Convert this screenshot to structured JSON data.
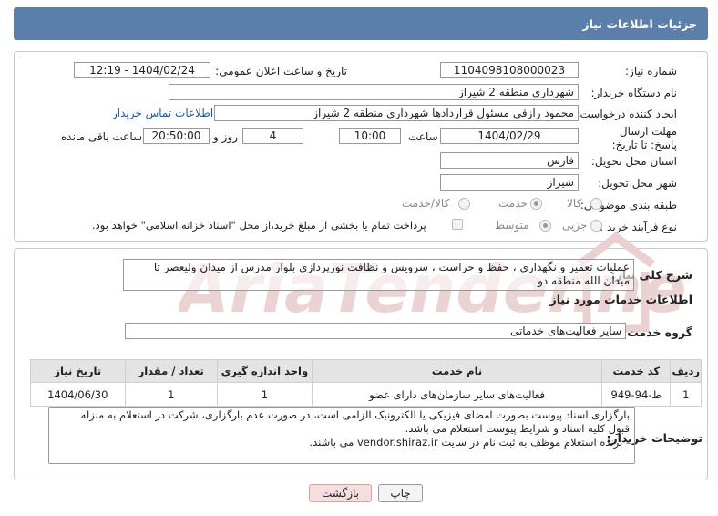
{
  "header": {
    "title": "جزئیات اطلاعات نیاز"
  },
  "need_number": {
    "label": "شماره نیاز:",
    "value": "1104098108000023"
  },
  "announce": {
    "label": "تاریخ و ساعت اعلان عمومی:",
    "value": "1404/02/24 - 12:19"
  },
  "buyer": {
    "label": "نام دستگاه خریدار:",
    "value": "شهرداری منطقه 2 شیراز"
  },
  "creator": {
    "label": "ایجاد کننده درخواست:",
    "value": "محمود رازقی مسئول قراردادها شهرداری منطقه 2 شیراز",
    "contact_link": "اطلاعات تماس خریدار"
  },
  "deadline": {
    "label": "مهلت ارسال پاسخ: تا تاریخ:",
    "date": "1404/02/29",
    "time_label": "ساعت",
    "time": "10:00",
    "days": "4",
    "days_label": "روز و",
    "remaining": "20:50:00",
    "remaining_label": "ساعت باقی مانده"
  },
  "province": {
    "label": "استان محل تحویل:",
    "value": "فارس"
  },
  "city": {
    "label": "شهر محل تحویل:",
    "value": "شیراز"
  },
  "category": {
    "label": "طبقه بندی موضوعی:",
    "options": [
      "کالا",
      "خدمت",
      "کالا/خدمت"
    ],
    "selected": "خدمت"
  },
  "process": {
    "label": "نوع فرآیند خرید :",
    "options": [
      "جزیی",
      "متوسط"
    ],
    "selected": "متوسط",
    "payment_note": "پرداخت تمام یا بخشی از مبلغ خرید،از محل \"اسناد خزانه اسلامی\" خواهد بود."
  },
  "description": {
    "label": "شرح کلی نیاز:",
    "text": "عملیات تعمیر و نگهداری ، حفظ و حراست ، سرویس و نظافت نورپردازی بلوار مدرس از میدان ولیعصر تا میدان الله منطقه دو"
  },
  "services_title": "اطلاعات خدمات مورد نیاز",
  "service_group": {
    "label": "گروه خدمت:",
    "value": "سایر فعالیت‌های خدماتی"
  },
  "table": {
    "headers": [
      "ردیف",
      "کد خدمت",
      "نام خدمت",
      "واحد اندازه گیری",
      "تعداد / مقدار",
      "تاریخ نیاز"
    ],
    "rows": [
      [
        "1",
        "ط-94-949",
        "فعالیت‌های سایر سازمان‌های دارای عضو",
        "1",
        "1",
        "1404/06/30"
      ]
    ]
  },
  "buyer_notes": {
    "label": "توضیحات خریدار:",
    "lines": [
      "بارگزاری اسناد پیوست بصورت امضای فیزیکی یا الکترونیک الزامی است، در صورت عدم بارگزاری، شرکت در استعلام به منزله",
      "قبول کلیه اسناد و شرایط پیوست استعلام می باشد.",
      "- برنده استعلام موظف به ثبت نام در سایت vendor.shiraz.ir می باشند."
    ]
  },
  "buttons": {
    "print": "چاپ",
    "back": "بازگشت"
  },
  "watermark": {
    "text": "AriaTender.net",
    "color": "#e6b5b5"
  }
}
